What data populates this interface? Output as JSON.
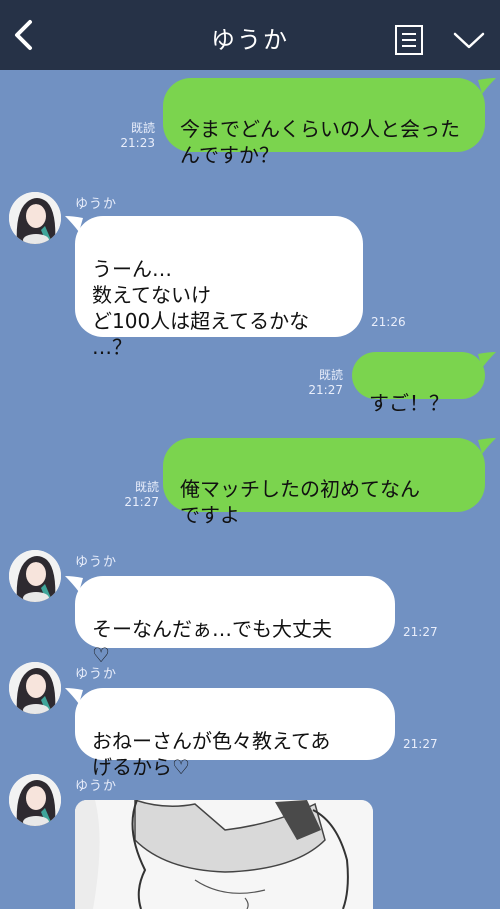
{
  "header": {
    "title": "ゆうか",
    "back_icon": "chevron-left-icon",
    "menu_icon": "notes-icon",
    "collapse_icon": "chevron-down-icon",
    "bg_color": "#263247"
  },
  "colors": {
    "background": "#7191c2",
    "outgoing_bubble": "#7bd44e",
    "incoming_bubble": "#ffffff"
  },
  "messages": [
    {
      "dir": "out",
      "text": "今までどんくらいの人と会ったんですか？",
      "read": "既読",
      "time": "21:23"
    },
    {
      "dir": "in",
      "sender": "ゆうか",
      "text": "うーん…\n数えてないけ\nど100人は超えてるかな\n…？",
      "time": "21:26"
    },
    {
      "dir": "out",
      "text": "すご！？",
      "read": "既読",
      "time": "21:27"
    },
    {
      "dir": "out",
      "text": "俺マッチしたの初めてなん\nですよ",
      "read": "既読",
      "time": "21:27"
    },
    {
      "dir": "in",
      "sender": "ゆうか",
      "text": "そーなんだぁ…でも大丈夫\n♡",
      "time": "21:27"
    },
    {
      "dir": "in",
      "sender": "ゆうか",
      "text": "おねーさんが色々教えてあ\nげるから♡",
      "time": "21:27"
    },
    {
      "dir": "in",
      "sender": "ゆうか",
      "type": "image"
    }
  ]
}
